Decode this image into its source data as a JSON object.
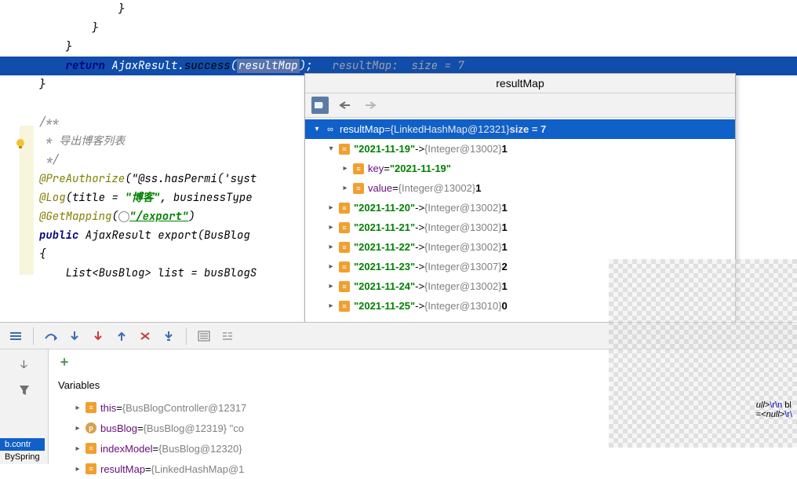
{
  "code": {
    "line1": "            }",
    "line2": "        }",
    "line3": "    }",
    "return_kw": "return",
    "return_class": " AjaxResult.",
    "return_method": "success",
    "return_var": "resultMap",
    "return_tail": ");",
    "hint_label": "resultMap:",
    "hint_value": "  size = 7",
    "line5": "}",
    "cmt1": "/**",
    "cmt2": " * 导出博客列表",
    "cmt3": " */",
    "ann1": "@PreAuthorize",
    "ann1_arg": "(\"@ss.hasPermi('syst",
    "ann2": "@Log",
    "ann2_arg1": "(title = ",
    "ann2_str": "\"博客\"",
    "ann2_arg2": ", businessType ",
    "ann3": "@GetMapping",
    "ann3_open": "(",
    "ann3_str": "\"/export\"",
    "ann3_close": ")",
    "sig_kw": "public",
    "sig_rest": " AjaxResult ",
    "sig_method": "export",
    "sig_params": "(BusBlog ",
    "brace": "{",
    "list_line1": "    List<BusBlog> list = busBlogS"
  },
  "popup": {
    "title": "resultMap",
    "root_name": "resultMap",
    "root_eq": " = ",
    "root_type": "{LinkedHashMap@12321} ",
    "root_tail": " size = 7",
    "entries": [
      {
        "key": "\"2021-11-19\"",
        "type": "{Integer@13002}",
        "val": "1",
        "expanded": true,
        "sub_key_label": "key",
        "sub_key_val": "\"2021-11-19\"",
        "sub_val_label": "value",
        "sub_val_type": "{Integer@13002}",
        "sub_val_val": "1"
      },
      {
        "key": "\"2021-11-20\"",
        "type": "{Integer@13002}",
        "val": "1"
      },
      {
        "key": "\"2021-11-21\"",
        "type": "{Integer@13002}",
        "val": "1"
      },
      {
        "key": "\"2021-11-22\"",
        "type": "{Integer@13002}",
        "val": "1"
      },
      {
        "key": "\"2021-11-23\"",
        "type": "{Integer@13007}",
        "val": "2"
      },
      {
        "key": "\"2021-11-24\"",
        "type": "{Integer@13002}",
        "val": "1"
      },
      {
        "key": "\"2021-11-25\"",
        "type": "{Integer@13010}",
        "val": "0"
      }
    ]
  },
  "debugger": {
    "vars_header": "Variables",
    "stack1": "b.contr",
    "stack2": "BySpring",
    "vars": [
      {
        "name": "this",
        "eq": " = ",
        "type": "{BusBlogController@12317"
      },
      {
        "name": "busBlog",
        "eq": " = ",
        "type": "{BusBlog@12319} \"co",
        "p": true
      },
      {
        "name": "indexModel",
        "eq": " = ",
        "type": "{BusBlog@12320}"
      },
      {
        "name": "resultMap",
        "eq": " = ",
        "type": "{LinkedHashMap@1"
      }
    ]
  },
  "side": {
    "l1a": "ull>",
    "l1b": "\\r\\n",
    "l1c": " bl",
    "l2a": "=<",
    "l2b": "null",
    "l2c": ">",
    "l2d": "\\r\\"
  }
}
